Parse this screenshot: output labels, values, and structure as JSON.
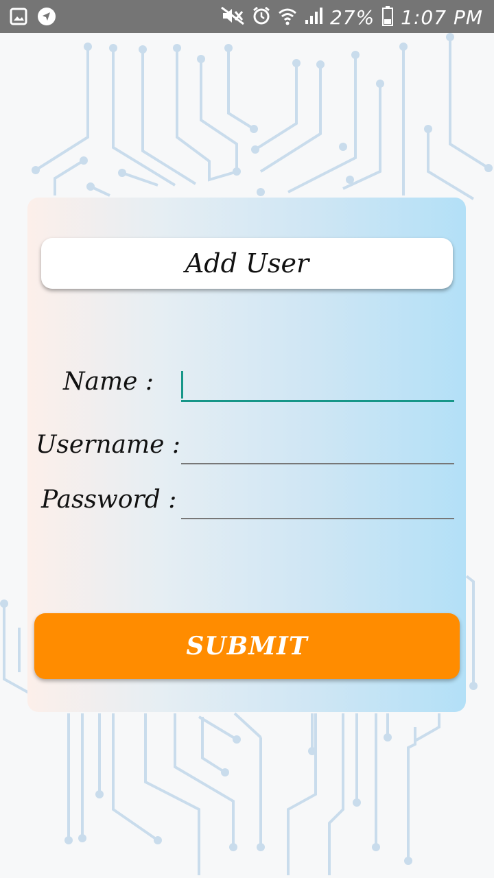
{
  "status_bar": {
    "left_icons": [
      "image-icon",
      "navigation-icon"
    ],
    "right_icons": [
      "mute-icon",
      "alarm-icon",
      "wifi-icon",
      "signal-icon",
      "battery-icon"
    ],
    "battery_percent": "27%",
    "time": "1:07 PM"
  },
  "form": {
    "title": "Add User",
    "name_label": "Name :",
    "name_value": "",
    "username_label": "Username :",
    "username_value": "",
    "password_label": "Password :",
    "password_value": "",
    "submit_label": "SUBMIT"
  },
  "colors": {
    "status_bar": "#757575",
    "accent": "#179688",
    "submit_button": "#ff8c00",
    "circuit_lines": "#c9dcec"
  }
}
